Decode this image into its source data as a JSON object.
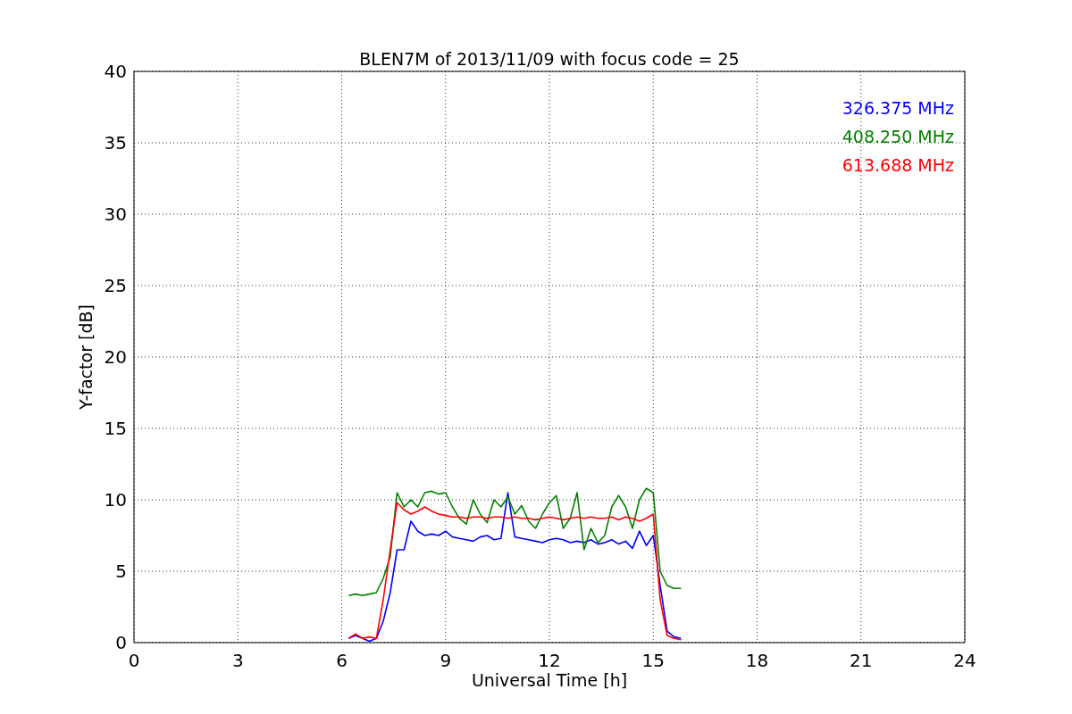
{
  "figure": {
    "chart_data": {
      "type": "line",
      "title": "BLEN7M of 2013/11/09 with focus code = 25",
      "xlabel": "Universal Time [h]",
      "ylabel": "Y-factor [dB]",
      "x": [
        6.2,
        6.4,
        6.6,
        6.8,
        7.0,
        7.2,
        7.4,
        7.6,
        7.8,
        8.0,
        8.2,
        8.4,
        8.6,
        8.8,
        9.0,
        9.2,
        9.4,
        9.6,
        9.8,
        10.0,
        10.2,
        10.4,
        10.6,
        10.8,
        11.0,
        11.2,
        11.4,
        11.6,
        11.8,
        12.0,
        12.2,
        12.4,
        12.6,
        12.8,
        13.0,
        13.2,
        13.4,
        13.6,
        13.8,
        14.0,
        14.2,
        14.4,
        14.6,
        14.8,
        15.0,
        15.2,
        15.4,
        15.6,
        15.8
      ],
      "series": [
        {
          "name": "326.375 MHz",
          "color": "#0000ff",
          "values": [
            0.3,
            0.5,
            0.3,
            0.1,
            0.3,
            1.5,
            3.5,
            6.5,
            6.5,
            8.5,
            7.8,
            7.5,
            7.6,
            7.5,
            7.8,
            7.4,
            7.3,
            7.2,
            7.1,
            7.4,
            7.5,
            7.2,
            7.3,
            10.5,
            7.4,
            7.3,
            7.2,
            7.1,
            7.0,
            7.2,
            7.3,
            7.2,
            7.0,
            7.1,
            7.0,
            7.2,
            6.9,
            7.0,
            7.2,
            6.9,
            7.1,
            6.6,
            7.8,
            6.8,
            7.5,
            4.0,
            0.8,
            0.4,
            0.3
          ]
        },
        {
          "name": "408.250 MHz",
          "color": "#008000",
          "values": [
            3.3,
            3.4,
            3.3,
            3.4,
            3.5,
            4.5,
            6.0,
            10.5,
            9.5,
            10.0,
            9.5,
            10.5,
            10.6,
            10.4,
            10.5,
            9.5,
            8.7,
            8.3,
            10.0,
            9.0,
            8.4,
            10.0,
            9.5,
            10.2,
            9.0,
            9.6,
            8.5,
            8.0,
            9.0,
            9.8,
            10.3,
            8.0,
            8.7,
            10.5,
            6.5,
            8.0,
            7.0,
            7.5,
            9.5,
            10.3,
            9.5,
            8.0,
            10.0,
            10.8,
            10.5,
            5.0,
            4.0,
            3.8,
            3.8
          ]
        },
        {
          "name": "613.688 MHz",
          "color": "#ff0000",
          "values": [
            0.3,
            0.6,
            0.3,
            0.4,
            0.3,
            3.0,
            6.5,
            9.8,
            9.3,
            9.0,
            9.2,
            9.5,
            9.2,
            9.0,
            8.9,
            8.8,
            8.8,
            8.7,
            8.8,
            8.8,
            8.7,
            8.8,
            8.8,
            8.7,
            8.8,
            8.7,
            8.7,
            8.6,
            8.7,
            8.8,
            8.7,
            8.6,
            8.7,
            8.8,
            8.7,
            8.8,
            8.7,
            8.7,
            8.8,
            8.6,
            8.8,
            8.7,
            8.5,
            8.7,
            9.0,
            3.0,
            0.5,
            0.3,
            0.2
          ]
        }
      ],
      "grid": true,
      "xlim": [
        0,
        24
      ],
      "ylim": [
        0,
        40
      ],
      "xticks": [
        0,
        3,
        6,
        9,
        12,
        15,
        18,
        21,
        24
      ],
      "yticks": [
        0,
        5,
        10,
        15,
        20,
        25,
        30,
        35,
        40
      ]
    }
  }
}
